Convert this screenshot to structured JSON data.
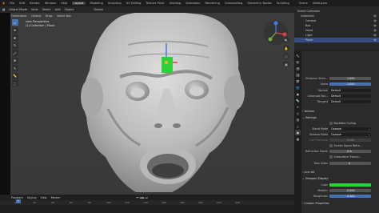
{
  "topbar": {
    "menus": [
      "File",
      "Edit",
      "Render",
      "Window",
      "Help"
    ],
    "workspaces": [
      "Layout",
      "Modeling",
      "Sculpting",
      "UV Editing",
      "Texture Paint",
      "Shading",
      "Animation",
      "Rendering",
      "Compositing",
      "Geometry Nodes",
      "Scripting"
    ],
    "active_workspace": "Layout",
    "scene": "Scene",
    "view_layer": "ViewLayer"
  },
  "viewport_header": {
    "mode": "Object Mode",
    "menus": [
      "View",
      "Select",
      "Add",
      "Object"
    ],
    "orientation_label": "Orientation:",
    "orientation_value": "Default",
    "drag_label": "Drag:",
    "drag_value": "Select Box",
    "transform_pivot": "Global"
  },
  "viewport": {
    "view_name": "User Perspective",
    "collection_info": "(1) Collection | Plane"
  },
  "outliner": {
    "rows": [
      {
        "label": "Scene Collection",
        "indent": 0,
        "selected": false
      },
      {
        "label": "Collection",
        "indent": 1,
        "selected": false
      },
      {
        "label": "Camera",
        "indent": 2,
        "selected": false
      },
      {
        "label": "Box",
        "indent": 2,
        "selected": false
      },
      {
        "label": "Head",
        "indent": 2,
        "selected": false
      },
      {
        "label": "Light",
        "indent": 2,
        "selected": false
      },
      {
        "label": "Plane",
        "indent": 2,
        "selected": true
      }
    ]
  },
  "properties": {
    "rows_top": [
      {
        "label": "Emission Stren...",
        "value": "1.000",
        "dark": false
      },
      {
        "label": "Alpha",
        "value": "1.000",
        "dark": false
      },
      {
        "label": "Normal",
        "value": "Default",
        "dark": true
      },
      {
        "label": "Clearcoat Nor...",
        "value": "Default",
        "dark": true
      },
      {
        "label": "Tangent",
        "value": "Default",
        "dark": true
      }
    ],
    "sections": {
      "volume": "Volume",
      "settings": "Settings",
      "line_art": "Line Art",
      "viewport_display": "Viewport Display",
      "custom_properties": "Custom Properties"
    },
    "backface_culling": "Backface Culling",
    "blend_mode_label": "Blend Mode",
    "blend_mode_value": "Opaque",
    "shadow_mode_label": "Shadow Mode",
    "shadow_mode_value": "Opaque",
    "clip_threshold_label": "Clip Threshold",
    "clip_threshold_value": "0.500",
    "screen_space_refraction": "Screen Space Refra...",
    "refraction_depth_label": "Refraction Depth",
    "refraction_depth_value": "0 m",
    "subsurface_translucency": "Subsurface Translu...",
    "pass_index_label": "Pass Index",
    "pass_index_value": "0",
    "color_label": "Color",
    "color_value": "#2fd13a",
    "metallic_label": "Metallic",
    "metallic_value": "0.000",
    "roughness_label": "Roughness",
    "roughness_value": "0.400"
  },
  "timeline": {
    "menus": [
      "Playback",
      "Keying",
      "View",
      "Marker"
    ],
    "current_frame": "1",
    "ruler": [
      "0",
      "20",
      "40",
      "60",
      "80",
      "100",
      "120",
      "140",
      "160",
      "180",
      "200",
      "220",
      "240"
    ]
  },
  "colors": {
    "accent": "#4772b3",
    "selected_outliner": "#334d80",
    "plane_green": "#2fd13a"
  }
}
